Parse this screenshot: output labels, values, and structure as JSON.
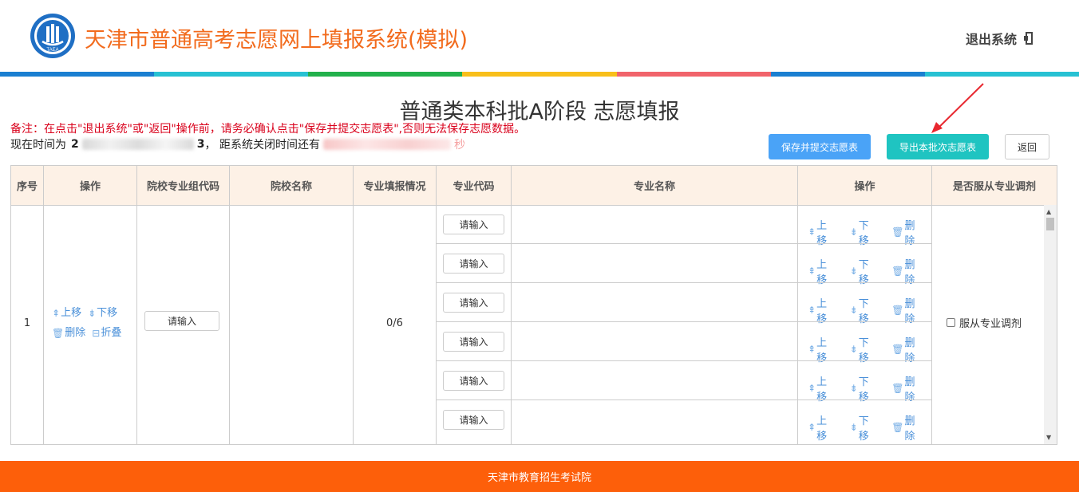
{
  "header": {
    "title": "天津市普通高考志愿网上填报系统(模拟)",
    "logo_text": "TAEA",
    "logout_label": "退出系统",
    "colorbar": [
      "#1a7fd1",
      "#27c1d3",
      "#22b14c",
      "#f8bf1a",
      "#f1646b",
      "#1a7fd1",
      "#27c1d3"
    ]
  },
  "page": {
    "heading": "普通类本科批A阶段 志愿填报",
    "note": "备注：在点击\"退出系统\"或\"返回\"操作前，请务必确认点击\"保存并提交志愿表\",否则无法保存志愿数据。",
    "time_prefix": "现在时间为",
    "time_first_char": "2",
    "time_tail": "3",
    "countdown_prefix": "，  距系统关闭时间还有",
    "countdown_suffix": "秒"
  },
  "buttons": {
    "save": "保存并提交志愿表",
    "export": "导出本批次志愿表",
    "back": "返回"
  },
  "table": {
    "headers": [
      "序号",
      "操作",
      "院校专业组代码",
      "院校名称",
      "专业填报情况",
      "专业代码",
      "专业名称",
      "操作",
      "是否服从专业调剂"
    ],
    "row": {
      "index": "1",
      "ops": {
        "up": "上移",
        "down": "下移",
        "delete": "删除",
        "fold": "折叠"
      },
      "group_code_placeholder": "请输入",
      "school_name": "",
      "fill_status": "0/6",
      "major_code_placeholder": "请输入",
      "major_ops": {
        "up": "上移",
        "down": "下移",
        "delete": "删除"
      },
      "obey_label": "服从专业调剂",
      "obey_checked": false
    },
    "major_rows": 6
  },
  "footer": {
    "text": "天津市教育招生考试院"
  },
  "colors": {
    "title_orange": "#f26b1d",
    "footer_orange": "#fd5f0a",
    "link_blue": "#4a90d9",
    "save_blue": "#4aa3f7",
    "export_teal": "#1fc4c1",
    "note_red": "#d9001b",
    "header_bg": "#fdf1e6",
    "annotation_red": "#e8272f"
  }
}
